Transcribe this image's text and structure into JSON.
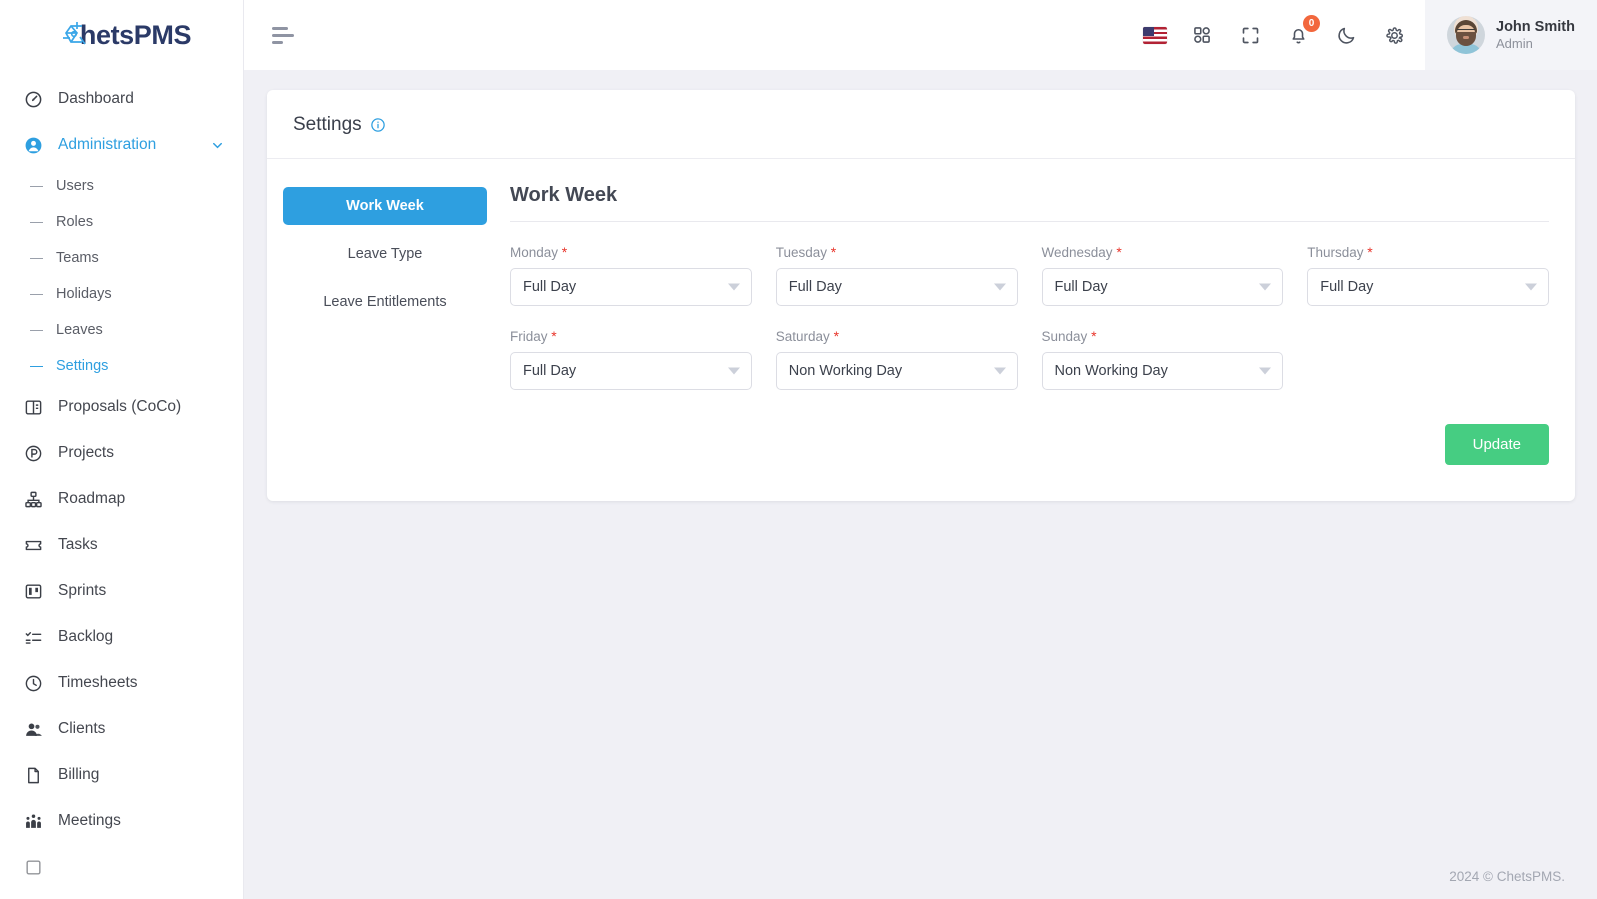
{
  "brand": {
    "name_prefix": "C",
    "name_mid": "hets",
    "name_suffix": "PMS",
    "accent": "#2e9fe0",
    "text_color": "#2b3a67"
  },
  "sidebar": {
    "items": [
      {
        "label": "Dashboard",
        "icon": "speedometer-icon",
        "type": "link",
        "active": false
      },
      {
        "label": "Administration",
        "icon": "user-circle-icon",
        "type": "group",
        "active": true
      },
      {
        "label": "Users",
        "icon": "dash-icon",
        "type": "sub",
        "active": false
      },
      {
        "label": "Roles",
        "icon": "dash-icon",
        "type": "sub",
        "active": false
      },
      {
        "label": "Teams",
        "icon": "dash-icon",
        "type": "sub",
        "active": false
      },
      {
        "label": "Holidays",
        "icon": "dash-icon",
        "type": "sub",
        "active": false
      },
      {
        "label": "Leaves",
        "icon": "dash-icon",
        "type": "sub",
        "active": false
      },
      {
        "label": "Settings",
        "icon": "dash-icon",
        "type": "sub",
        "active": true
      },
      {
        "label": "Proposals (CoCo)",
        "icon": "proposal-icon",
        "type": "link",
        "active": false
      },
      {
        "label": "Projects",
        "icon": "project-circle-p-icon",
        "type": "link",
        "active": false
      },
      {
        "label": "Roadmap",
        "icon": "hierarchy-icon",
        "type": "link",
        "active": false
      },
      {
        "label": "Tasks",
        "icon": "ticket-icon",
        "type": "link",
        "active": false
      },
      {
        "label": "Sprints",
        "icon": "board-icon",
        "type": "link",
        "active": false
      },
      {
        "label": "Backlog",
        "icon": "checklist-icon",
        "type": "link",
        "active": false
      },
      {
        "label": "Timesheets",
        "icon": "clock-icon",
        "type": "link",
        "active": false
      },
      {
        "label": "Clients",
        "icon": "users-icon",
        "type": "link",
        "active": false
      },
      {
        "label": "Billing",
        "icon": "document-icon",
        "type": "link",
        "active": false
      },
      {
        "label": "Meetings",
        "icon": "people-group-icon",
        "type": "link",
        "active": false
      }
    ]
  },
  "topbar": {
    "menu_toggle": "hamburger-icon",
    "language_flag": "us-flag-icon",
    "apps": "grid-apps-icon",
    "fullscreen": "fullscreen-icon",
    "notifications_icon": "bell-icon",
    "notifications_count": "0",
    "theme": "moon-icon",
    "settings": "gear-icon",
    "user": {
      "name": "John Smith",
      "role": "Admin",
      "avatar": "user-avatar"
    }
  },
  "page": {
    "title": "Settings",
    "info_icon": "info-circle-icon"
  },
  "tabs": [
    {
      "label": "Work Week",
      "active": true
    },
    {
      "label": "Leave Type",
      "active": false
    },
    {
      "label": "Leave Entitlements",
      "active": false
    }
  ],
  "form": {
    "heading": "Work Week",
    "required_marker": "*",
    "fields": [
      {
        "label": "Monday",
        "value": "Full Day",
        "required": true
      },
      {
        "label": "Tuesday",
        "value": "Full Day",
        "required": true
      },
      {
        "label": "Wednesday",
        "value": "Full Day",
        "required": true
      },
      {
        "label": "Thursday",
        "value": "Full Day",
        "required": true
      },
      {
        "label": "Friday",
        "value": "Full Day",
        "required": true
      },
      {
        "label": "Saturday",
        "value": "Non Working Day",
        "required": true
      },
      {
        "label": "Sunday",
        "value": "Non Working Day",
        "required": true
      }
    ],
    "submit_label": "Update",
    "submit_color": "#46cd82"
  },
  "footer": {
    "copyright": "2024 © ChetsPMS."
  }
}
